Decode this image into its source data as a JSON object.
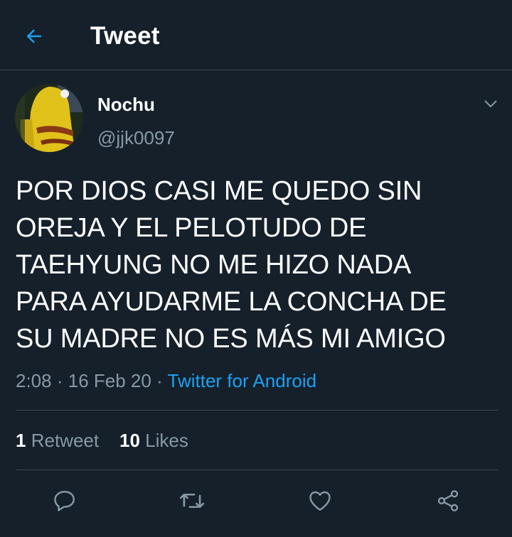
{
  "header": {
    "title": "Tweet",
    "back_icon": "arrow-left-icon"
  },
  "colors": {
    "background": "#15202b",
    "accent": "#1da1f2",
    "muted": "#8899a6",
    "divider": "#38444d"
  },
  "tweet": {
    "author_name": "Nochu",
    "author_handle": "@jjk0097",
    "text": "POR DIOS CASI ME QUEDO SIN\nOREJA Y EL PELOTUDO DE\nTAEHYUNG NO ME HIZO NADA\nPARA AYUDARME LA CONCHA DE\nSU MADRE NO ES MÁS MI AMIGO",
    "time": "2:08",
    "date": "16 Feb 20",
    "separator": "·",
    "source": "Twitter for Android",
    "retweet_count": "1",
    "retweet_label": "Retweet",
    "like_count": "10",
    "like_label": "Likes"
  },
  "actions": [
    "reply-icon",
    "retweet-icon",
    "like-icon",
    "share-icon"
  ]
}
